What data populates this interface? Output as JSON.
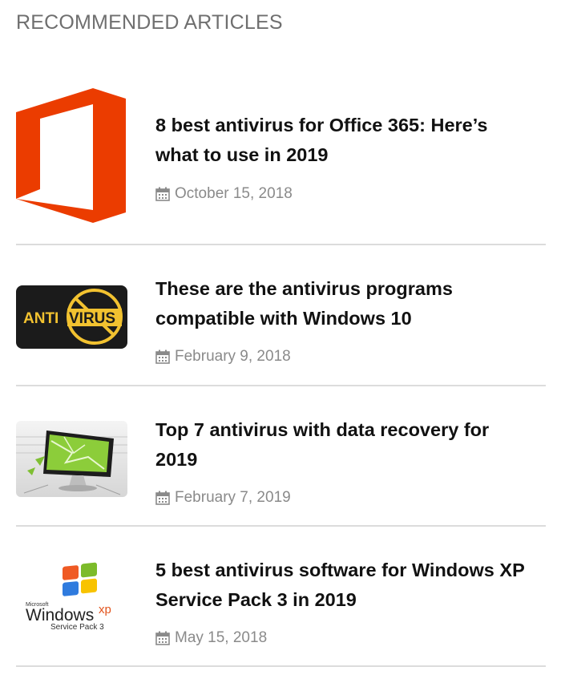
{
  "section": {
    "title": "RECOMMENDED ARTICLES"
  },
  "articles": [
    {
      "title": "8 best antivirus for Office 365: Here’s what to use in 2019",
      "date": "October 15, 2018",
      "thumb": "office-logo"
    },
    {
      "title": "These are the antivirus programs compatible with Windows 10",
      "date": "February 9, 2018",
      "thumb": "antivirus-badge",
      "thumb_text_left": "ANTI",
      "thumb_text_right": "VIRUS"
    },
    {
      "title": "Top 7 antivirus with data recovery for 2019",
      "date": "February 7, 2019",
      "thumb": "broken-monitor"
    },
    {
      "title": "5 best antivirus software for Windows XP Service Pack 3 in 2019",
      "date": "May 15, 2018",
      "thumb": "windows-xp-logo",
      "thumb_text_microsoft": "Microsoft",
      "thumb_text_windows": "Windows",
      "thumb_text_xp": "xp",
      "thumb_text_sp": "Service Pack 3"
    }
  ],
  "colors": {
    "office_orange": "#EB3C00",
    "antivirus_yellow": "#F2C230",
    "title": "#111111",
    "muted": "#8a8a8a"
  }
}
